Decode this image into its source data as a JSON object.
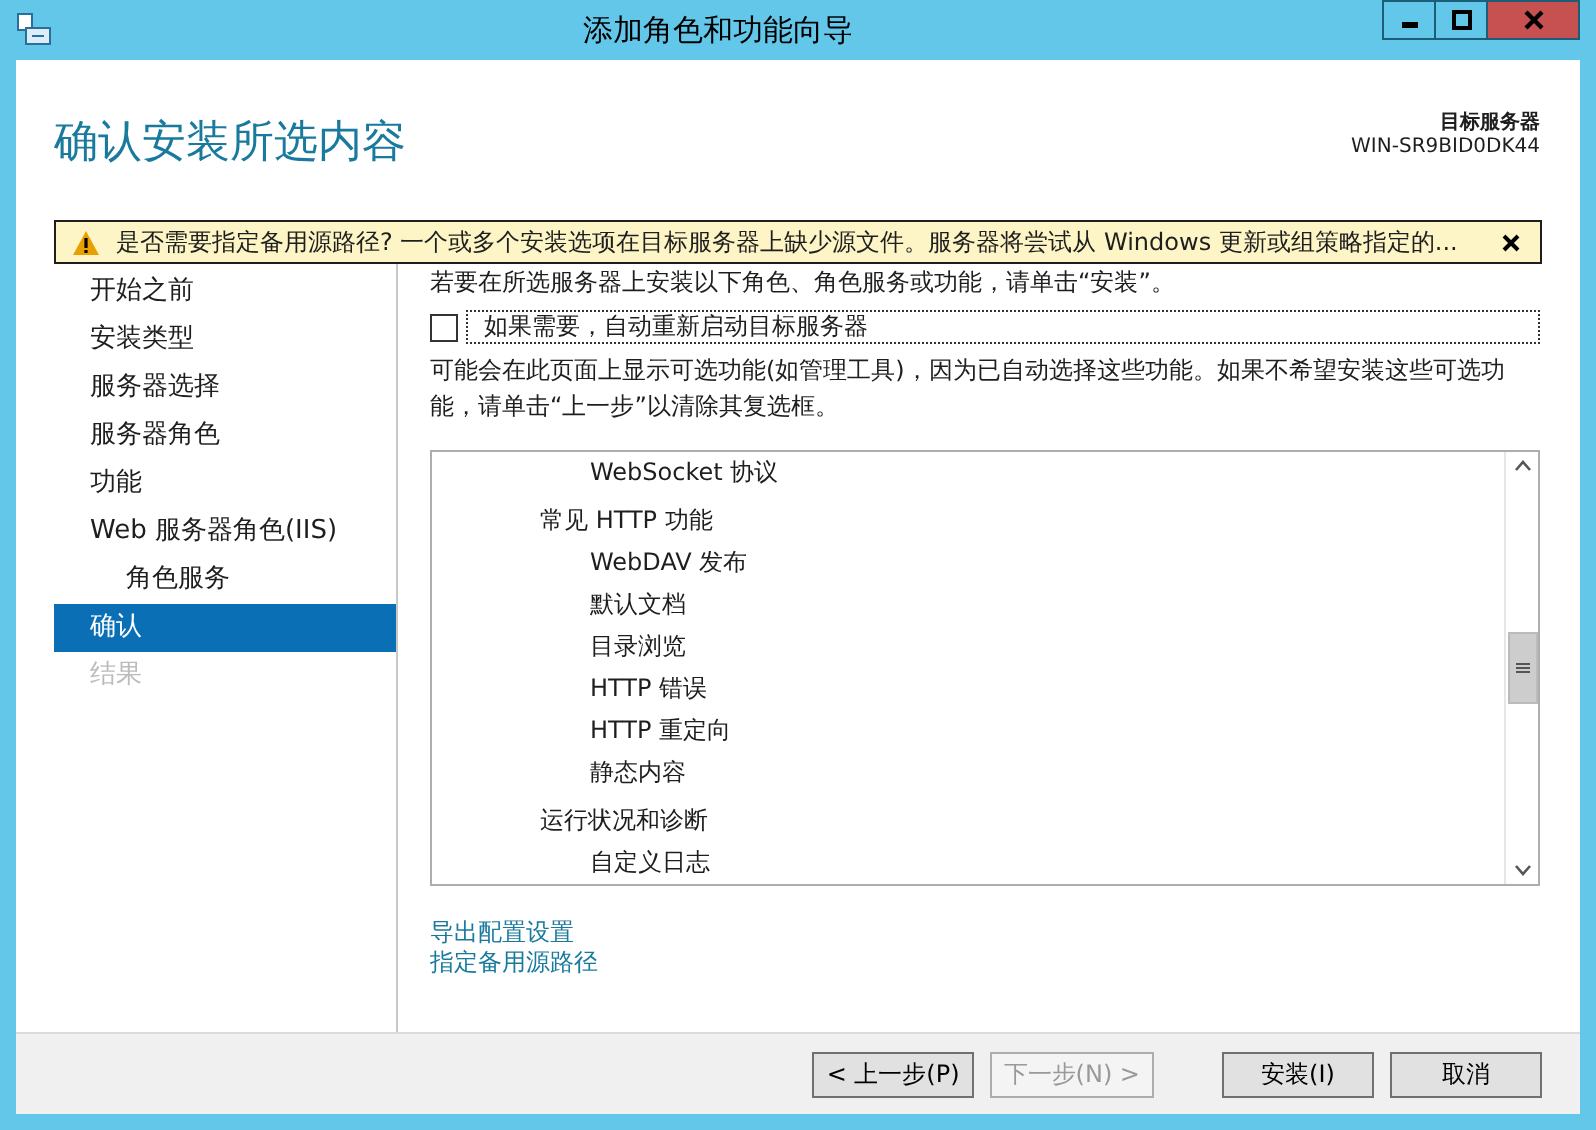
{
  "window": {
    "title": "添加角色和功能向导"
  },
  "header": {
    "title": "确认安装所选内容",
    "server_label": "目标服务器",
    "server_name": "WIN-SR9BID0DK44"
  },
  "warning": {
    "text": "是否需要指定备用源路径? 一个或多个安装选项在目标服务器上缺少源文件。服务器将尝试从 Windows 更新或组策略指定的..."
  },
  "sidebar": {
    "items": [
      {
        "label": "开始之前",
        "selected": false,
        "disabled": false,
        "indented": false
      },
      {
        "label": "安装类型",
        "selected": false,
        "disabled": false,
        "indented": false
      },
      {
        "label": "服务器选择",
        "selected": false,
        "disabled": false,
        "indented": false
      },
      {
        "label": "服务器角色",
        "selected": false,
        "disabled": false,
        "indented": false
      },
      {
        "label": "功能",
        "selected": false,
        "disabled": false,
        "indented": false
      },
      {
        "label": "Web 服务器角色(IIS)",
        "selected": false,
        "disabled": false,
        "indented": false
      },
      {
        "label": "角色服务",
        "selected": false,
        "disabled": false,
        "indented": true
      },
      {
        "label": "确认",
        "selected": true,
        "disabled": false,
        "indented": false
      },
      {
        "label": "结果",
        "selected": false,
        "disabled": true,
        "indented": false
      }
    ]
  },
  "intro": "若要在所选服务器上安装以下角色、角色服务或功能，请单击“安装”。",
  "restart_checkbox": {
    "label": "如果需要，自动重新启动目标服务器",
    "checked": false
  },
  "note": "可能会在此页面上显示可选功能(如管理工具)，因为已自动选择这些功能。如果不希望安装这些可选功能，请单击“上一步”以清除其复选框。",
  "tree": [
    {
      "children": [
        {
          "label": "WebSocket 协议"
        }
      ]
    },
    {
      "label": "常见 HTTP 功能",
      "children": [
        {
          "label": "WebDAV 发布"
        },
        {
          "label": "默认文档"
        },
        {
          "label": "目录浏览"
        },
        {
          "label": "HTTP 错误"
        },
        {
          "label": "HTTP 重定向"
        },
        {
          "label": "静态内容"
        }
      ]
    },
    {
      "label": "运行状况和诊断",
      "children": [
        {
          "label": "自定义日志"
        }
      ]
    }
  ],
  "links": [
    "导出配置设置",
    "指定备用源路径"
  ],
  "buttons": [
    {
      "label": "< 上一步(P)",
      "disabled": false
    },
    {
      "label": "下一步(N) >",
      "disabled": true
    },
    {
      "label": "安装(I)",
      "disabled": false
    },
    {
      "label": "取消",
      "disabled": false
    }
  ]
}
